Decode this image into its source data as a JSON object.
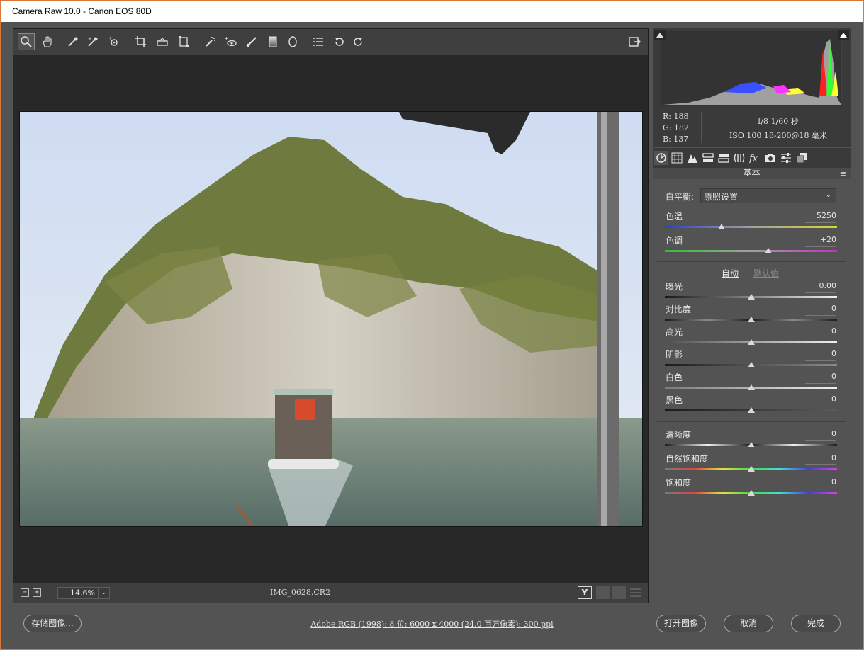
{
  "window": {
    "title": "Camera Raw 10.0 -  Canon EOS 80D"
  },
  "toolbar": {
    "tools": [
      "zoom-tool-icon",
      "hand-tool-icon",
      "white-balance-tool-icon",
      "color-sampler-icon",
      "targeted-adjustment-icon",
      "crop-tool-icon",
      "straighten-tool-icon",
      "transform-tool-icon",
      "spot-removal-icon",
      "red-eye-icon",
      "adjustment-brush-icon",
      "graduated-filter-icon",
      "radial-filter-icon",
      "preferences-icon",
      "rotate-left-icon",
      "rotate-right-icon"
    ],
    "export": "open-in-photoshop-icon"
  },
  "status": {
    "zoom_minus": "−",
    "zoom_plus": "+",
    "zoom_value": "14.6%",
    "filename": "IMG_0628.CR2",
    "compare_label": "Y"
  },
  "histogram_info": {
    "r": "R:  188",
    "g": "G:  182",
    "b": "B:  137",
    "exposure_line1": "f/8   1/60 秒",
    "exposure_line2": "ISO 100   18-200@18 毫米"
  },
  "panel": {
    "title": "基本",
    "menu_icon": "≡",
    "tabs": [
      "basic-tab-icon",
      "tone-curve-tab-icon",
      "detail-tab-icon",
      "hsl-tab-icon",
      "split-toning-tab-icon",
      "lens-corrections-tab-icon",
      "effects-tab-icon",
      "camera-calibration-tab-icon",
      "presets-tab-icon",
      "snapshots-tab-icon"
    ]
  },
  "basic": {
    "wb_label": "白平衡:",
    "wb_value": "原照设置",
    "temperature": {
      "label": "色温",
      "value": "5250",
      "level": 0.33
    },
    "tint": {
      "label": "色调",
      "value": "+20",
      "level": 0.6
    },
    "auto": "自动",
    "default": "默认值",
    "sliders": [
      {
        "label": "曝光",
        "value": "0.00",
        "level": 0.5
      },
      {
        "label": "对比度",
        "value": "0",
        "level": 0.5
      },
      {
        "label": "高光",
        "value": "0",
        "level": 0.5
      },
      {
        "label": "阴影",
        "value": "0",
        "level": 0.5
      },
      {
        "label": "白色",
        "value": "0",
        "level": 0.5
      },
      {
        "label": "黑色",
        "value": "0",
        "level": 0.5
      }
    ],
    "presence": [
      {
        "label": "清晰度",
        "value": "0",
        "level": 0.5
      },
      {
        "label": "自然饱和度",
        "value": "0",
        "level": 0.5
      },
      {
        "label": "饱和度",
        "value": "0",
        "level": 0.5
      }
    ]
  },
  "footer": {
    "save_button": "存储图像...",
    "workflow_link": "Adobe RGB (1998); 8 位; 6000 x 4000 (24.0 百万像素); 300 ppi",
    "open_button": "打开图像",
    "cancel_button": "取消",
    "done_button": "完成"
  },
  "colors": {
    "accent_border": "#d87a3a",
    "panel_bg": "#535353",
    "dark_bg": "#282828"
  }
}
